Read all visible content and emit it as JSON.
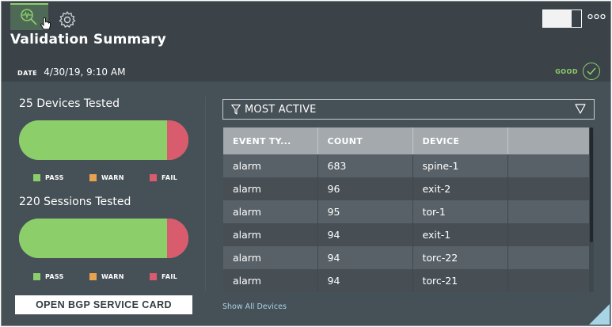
{
  "card": {
    "title": "Validation Summary",
    "date_label": "DATE",
    "date_value": "4/30/19, 9:10 AM",
    "status": "GOOD",
    "tabs": [
      {
        "icon": "validation-icon",
        "active": true
      },
      {
        "icon": "gear-icon",
        "active": false
      }
    ]
  },
  "devices": {
    "title": "25 Devices Tested",
    "pass_fraction": 0.875,
    "warn_fraction": 0.0,
    "fail_fraction": 0.125
  },
  "sessions": {
    "title": "220 Sessions Tested",
    "pass_fraction": 0.875,
    "warn_fraction": 0.0,
    "fail_fraction": 0.125
  },
  "legend": {
    "pass": "PASS",
    "warn": "WARN",
    "fail": "FAIL"
  },
  "colors": {
    "pass": "#8ccf6a",
    "warn": "#e8a250",
    "fail": "#d95b6e",
    "good": "#8ccf6a"
  },
  "open_button": "OPEN BGP SERVICE CARD",
  "filter": {
    "label": "MOST ACTIVE"
  },
  "table": {
    "headers": [
      "EVENT TY...",
      "COUNT",
      "DEVICE",
      ""
    ],
    "rows": [
      [
        "alarm",
        "683",
        "spine-1"
      ],
      [
        "alarm",
        "96",
        "exit-2"
      ],
      [
        "alarm",
        "95",
        "tor-1"
      ],
      [
        "alarm",
        "94",
        "exit-1"
      ],
      [
        "alarm",
        "94",
        "torc-22"
      ],
      [
        "alarm",
        "94",
        "torc-21"
      ]
    ]
  },
  "show_all_link": "Show All Devices"
}
